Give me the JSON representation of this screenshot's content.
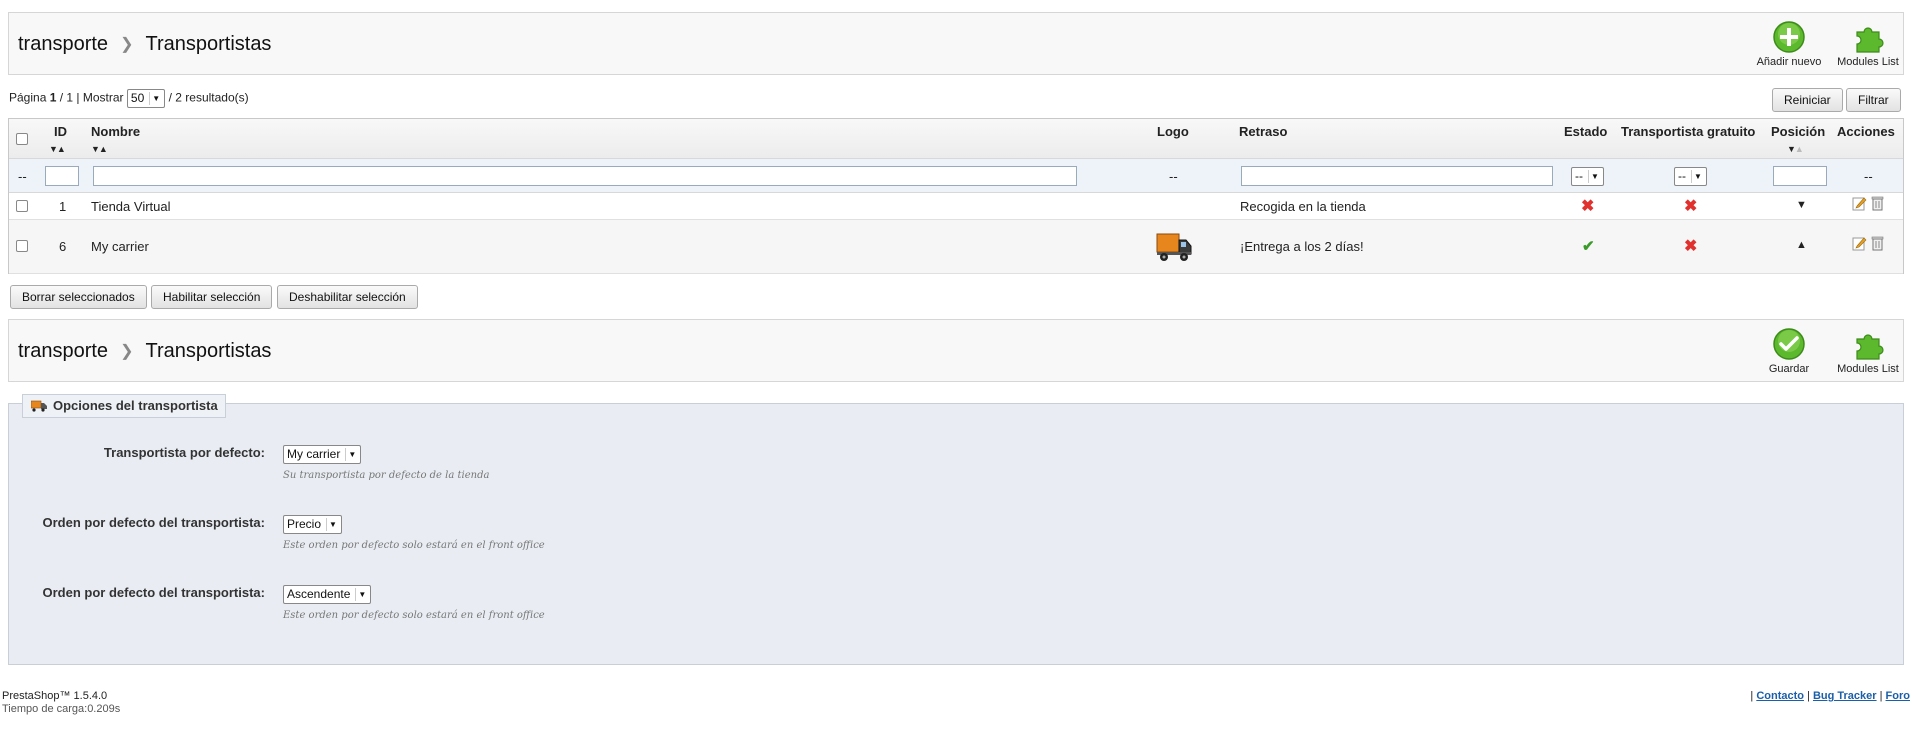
{
  "top_toolbar": {
    "crumb_parent": "transporte",
    "crumb_current": "Transportistas",
    "add_new_label": "Añadir nuevo",
    "modules_list_label": "Modules List"
  },
  "pager": {
    "page_label": "Página",
    "page_current": "1",
    "page_total": "/ 1 | Mostrar",
    "per_page": "50",
    "results": "/ 2 resultado(s)"
  },
  "filter_buttons": {
    "reset": "Reiniciar",
    "filter": "Filtrar"
  },
  "table": {
    "columns": {
      "id": "ID",
      "name": "Nombre",
      "logo": "Logo",
      "delay": "Retraso",
      "status": "Estado",
      "free": "Transportista gratuito",
      "position": "Posición",
      "actions": "Acciones"
    },
    "filter_row": {
      "checkbox_placeholder": "--",
      "logo_placeholder": "--",
      "status_select": "--",
      "free_select": "--",
      "actions_placeholder": "--"
    },
    "rows": [
      {
        "id": "1",
        "name": "Tienda Virtual",
        "delay": "Recogida en la tienda",
        "status": "disabled",
        "free": "no",
        "position": "down"
      },
      {
        "id": "6",
        "name": "My carrier",
        "delay": "¡Entrega a los 2 días!",
        "status": "enabled",
        "free": "no",
        "position": "up"
      }
    ]
  },
  "bulk": {
    "delete": "Borrar seleccionados",
    "enable": "Habilitar selección",
    "disable": "Deshabilitar selección"
  },
  "bottom_toolbar": {
    "crumb_parent": "transporte",
    "crumb_current": "Transportistas",
    "save_label": "Guardar",
    "modules_list_label": "Modules List"
  },
  "options": {
    "legend": "Opciones del transportista",
    "fields": [
      {
        "label": "Transportista por defecto:",
        "value": "My carrier",
        "help": "Su transportista por defecto de la tienda"
      },
      {
        "label": "Orden por defecto del transportista:",
        "value": "Precio",
        "help": "Este orden por defecto solo estará en el front office"
      },
      {
        "label": "Orden por defecto del transportista:",
        "value": "Ascendente",
        "help": "Este orden por defecto solo estará en el front office"
      }
    ]
  },
  "footer": {
    "version": "PrestaShop™ 1.5.4.0",
    "load_time": "Tiempo de carga:0.209s",
    "sep": "|",
    "contact": "Contacto",
    "bug_tracker": "Bug Tracker",
    "forum": "Foro"
  },
  "colors": {
    "accent_green": "#5cb82c",
    "error_red": "#e0312e",
    "link_blue": "#1a5fa8",
    "fieldset_bg": "#e9edf3"
  }
}
